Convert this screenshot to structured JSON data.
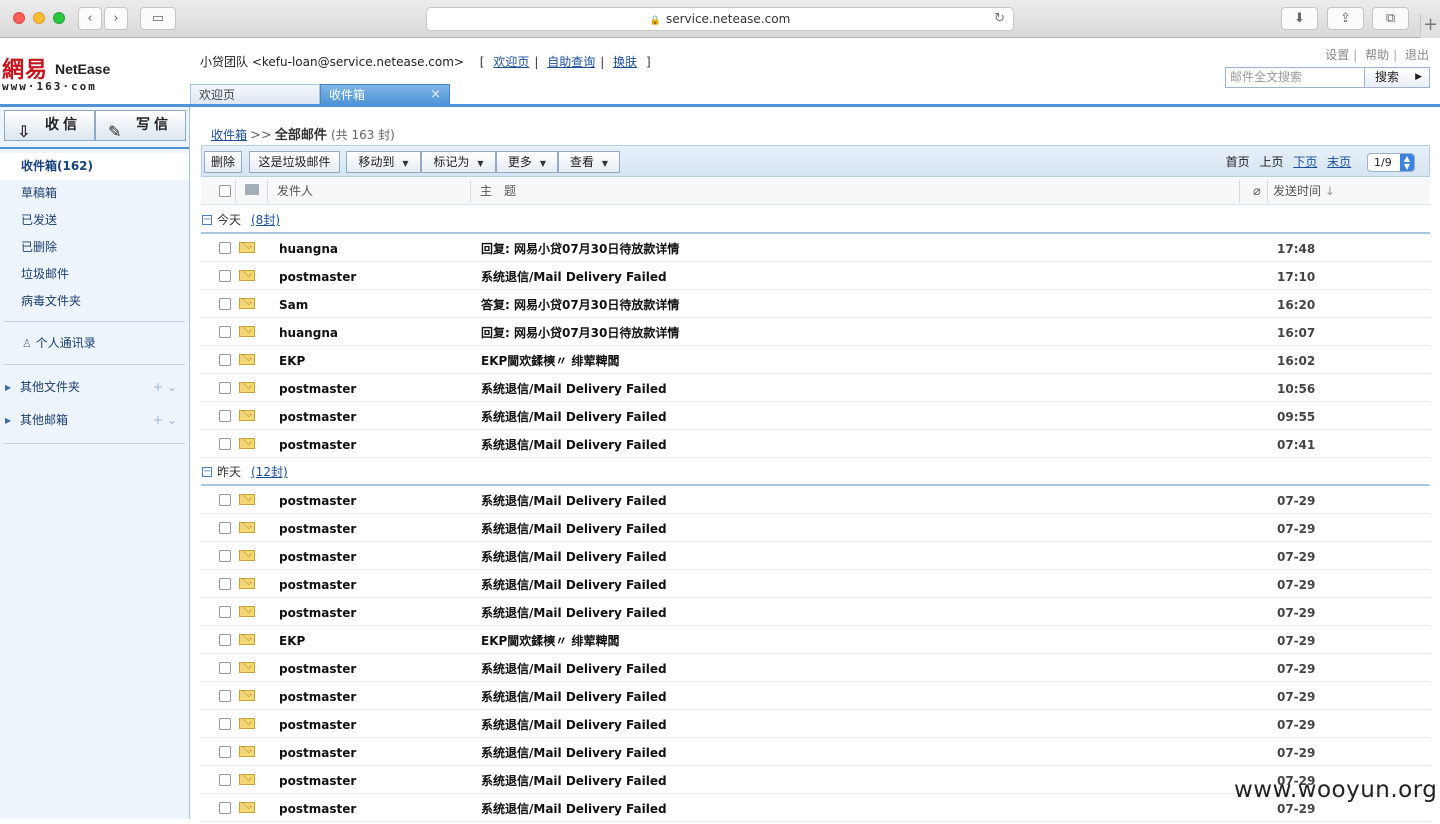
{
  "browser": {
    "url": "service.netease.com"
  },
  "header": {
    "logo_cn": "網易",
    "logo_en": "NetEase",
    "logo_www": "www·163·com",
    "user_name": "小贷团队",
    "user_email": "<kefu-loan@service.netease.com>",
    "links": [
      "欢迎页",
      "自助查询",
      "换肤"
    ],
    "top_links": [
      "设置",
      "帮助",
      "退出"
    ],
    "search_placeholder": "邮件全文搜索",
    "search_label": "搜索"
  },
  "tabs": [
    {
      "label": "欢迎页"
    },
    {
      "label": "收件箱",
      "close": "×"
    }
  ],
  "sidebar": {
    "receive_label": "收信",
    "write_label": "写信",
    "folders": [
      {
        "label": "收件箱(162)"
      },
      {
        "label": "草稿箱"
      },
      {
        "label": "已发送"
      },
      {
        "label": "已删除"
      },
      {
        "label": "垃圾邮件"
      },
      {
        "label": "病毒文件夹"
      }
    ],
    "contacts_label": "个人通讯录",
    "other_folders_label": "其他文件夹",
    "other_mailboxes_label": "其他邮箱"
  },
  "main": {
    "crumb_link": "收件箱",
    "crumb_sep": ">>",
    "crumb_title": "全部邮件",
    "crumb_count": "(共 163 封)",
    "toolbar": {
      "delete": "删除",
      "spam": "这是垃圾邮件",
      "move": "移动到",
      "mark": "标记为",
      "more": "更多",
      "view": "查看"
    },
    "pager": {
      "first": "首页",
      "prev": "上页",
      "next": "下页",
      "last": "末页",
      "page": "1/9"
    },
    "columns": {
      "from": "发件人",
      "subject": "主　题",
      "time": "发送时间"
    },
    "groups": [
      {
        "name": "今天",
        "count": "(8封)",
        "rows": [
          {
            "from": "huangna",
            "subject": "回复: 网易小贷07月30日待放款详情",
            "time": "17:48"
          },
          {
            "from": "postmaster",
            "subject": "系统退信/Mail Delivery Failed",
            "time": "17:10"
          },
          {
            "from": "Sam",
            "subject": "答复: 网易小贷07月30日待放款详情",
            "time": "16:20"
          },
          {
            "from": "huangna",
            "subject": "回复: 网易小贷07月30日待放款详情",
            "time": "16:07"
          },
          {
            "from": "EKP",
            "subject": "EKP閫欢鍒樉〃 绯荤粺闆",
            "time": "16:02"
          },
          {
            "from": "postmaster",
            "subject": "系统退信/Mail Delivery Failed",
            "time": "10:56"
          },
          {
            "from": "postmaster",
            "subject": "系统退信/Mail Delivery Failed",
            "time": "09:55"
          },
          {
            "from": "postmaster",
            "subject": "系统退信/Mail Delivery Failed",
            "time": "07:41"
          }
        ]
      },
      {
        "name": "昨天",
        "count": "(12封)",
        "rows": [
          {
            "from": "postmaster",
            "subject": "系统退信/Mail Delivery Failed",
            "time": "07-29"
          },
          {
            "from": "postmaster",
            "subject": "系统退信/Mail Delivery Failed",
            "time": "07-29"
          },
          {
            "from": "postmaster",
            "subject": "系统退信/Mail Delivery Failed",
            "time": "07-29"
          },
          {
            "from": "postmaster",
            "subject": "系统退信/Mail Delivery Failed",
            "time": "07-29"
          },
          {
            "from": "postmaster",
            "subject": "系统退信/Mail Delivery Failed",
            "time": "07-29"
          },
          {
            "from": "EKP",
            "subject": "EKP閫欢鍒樉〃 绯荤粺闆",
            "time": "07-29"
          },
          {
            "from": "postmaster",
            "subject": "系统退信/Mail Delivery Failed",
            "time": "07-29"
          },
          {
            "from": "postmaster",
            "subject": "系统退信/Mail Delivery Failed",
            "time": "07-29"
          },
          {
            "from": "postmaster",
            "subject": "系统退信/Mail Delivery Failed",
            "time": "07-29"
          },
          {
            "from": "postmaster",
            "subject": "系统退信/Mail Delivery Failed",
            "time": "07-29"
          },
          {
            "from": "postmaster",
            "subject": "系统退信/Mail Delivery Failed",
            "time": "07-29"
          },
          {
            "from": "postmaster",
            "subject": "系统退信/Mail Delivery Failed",
            "time": "07-29"
          }
        ]
      }
    ]
  },
  "watermark": "www.wooyun.org",
  "colors": {
    "accent": "#4d93d6",
    "sidebar_bg": "#eef4fb",
    "link": "#1a4f9c"
  }
}
